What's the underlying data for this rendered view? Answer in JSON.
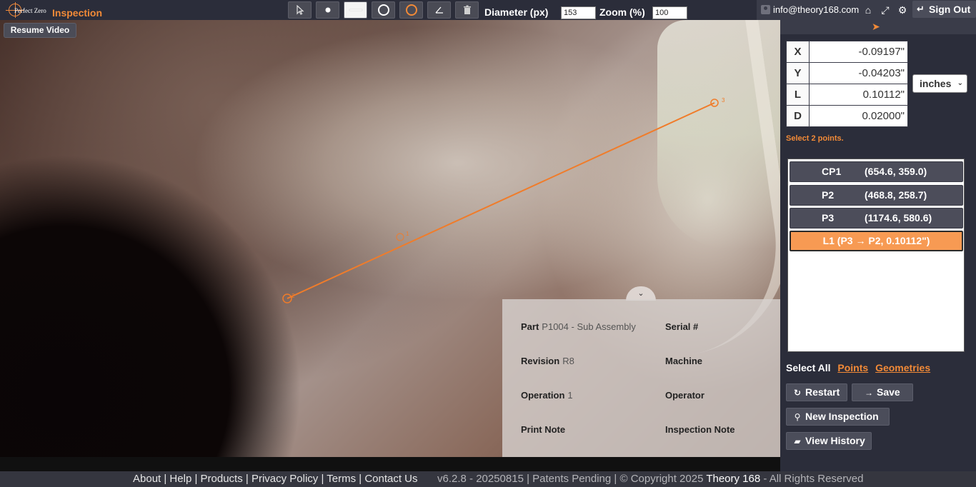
{
  "header": {
    "logo_text": "Perfect Zero",
    "title": "Inspection",
    "diameter_label": "Diameter (px)",
    "diameter_value": "153",
    "zoom_label": "Zoom (%)",
    "zoom_value": "100",
    "user_email": "info@theory168.com",
    "signout_label": "Sign Out",
    "tools": [
      "pointer-tool",
      "point-tool",
      "line-tool",
      "circle-tool",
      "arc-tool",
      "angle-tool",
      "delete-tool"
    ],
    "selected_tool": "line-tool"
  },
  "video": {
    "resume_label": "Resume Video",
    "marker_labels": [
      "1",
      "2",
      "3"
    ]
  },
  "info_panel": {
    "part_label": "Part",
    "part_value": "P1004 - Sub Assembly",
    "serial_label": "Serial #",
    "revision_label": "Revision",
    "revision_value": "R8",
    "machine_label": "Machine",
    "operation_label": "Operation",
    "operation_value": "1",
    "operator_label": "Operator",
    "print_note_label": "Print Note",
    "inspection_note_label": "Inspection Note"
  },
  "measurement": {
    "rows": [
      {
        "key": "X",
        "value": "-0.09197\""
      },
      {
        "key": "Y",
        "value": "-0.04203\""
      },
      {
        "key": "L",
        "value": "0.10112\""
      },
      {
        "key": "D",
        "value": "0.02000\""
      }
    ],
    "units": "inches",
    "hint": "Select 2 points."
  },
  "features": [
    {
      "name": "CP1",
      "coords": "(654.6, 359.0)",
      "active": false
    },
    {
      "name": "P2",
      "coords": "(468.8, 258.7)",
      "active": false
    },
    {
      "name": "P3",
      "coords": "(1174.6, 580.6)",
      "active": false
    },
    {
      "name": "L1 (P3 → P2, 0.10112\")",
      "coords": "",
      "active": true
    }
  ],
  "selection": {
    "select_all": "Select All",
    "points": "Points",
    "geometries": "Geometries"
  },
  "actions": {
    "restart": "Restart",
    "save": "Save",
    "new_inspection": "New Inspection",
    "view_history": "View History"
  },
  "footer": {
    "links": "About | Help | Products | Privacy Policy | Terms | Contact Us",
    "version": "v6.2.8 - 20250815 | Patents Pending | © Copyright 2025 ",
    "brand": "Theory 168",
    "rights": " - All Rights Reserved"
  },
  "colors": {
    "accent": "#f28a37",
    "panel": "#2b2d3a",
    "button": "#4b4d5a"
  }
}
